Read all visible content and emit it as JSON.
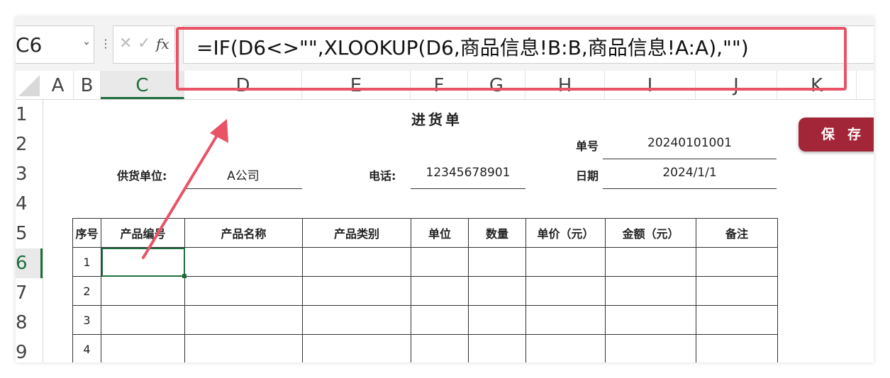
{
  "name_box": {
    "value": "C6",
    "dropdown_icon": "chevron-down-icon"
  },
  "formula_bar": {
    "cancel_icon": "cancel-x-icon",
    "confirm_icon": "checkmark-icon",
    "fx_label": "fx",
    "formula": "=IF(D6<>\"\",XLOOKUP(D6,商品信息!B:B,商品信息!A:A),\"\")"
  },
  "columns": [
    "A",
    "B",
    "C",
    "D",
    "E",
    "F",
    "G",
    "H",
    "I",
    "J",
    "K"
  ],
  "selected_column": "C",
  "rows": [
    "1",
    "2",
    "3",
    "4",
    "5",
    "6",
    "7",
    "8",
    "9"
  ],
  "selected_row": "6",
  "sheet": {
    "title": "进货单",
    "order_no_label": "单号",
    "order_no": "20240101001",
    "supplier_label": "供货单位:",
    "supplier": "A公司",
    "phone_label": "电话:",
    "phone": "12345678901",
    "date_label": "日期",
    "date": "2024/1/1",
    "table": {
      "headers": [
        "序号",
        "产品编号",
        "产品名称",
        "产品类别",
        "单位",
        "数量",
        "单价（元）",
        "金额（元）",
        "备注"
      ],
      "row_numbers": [
        "1",
        "2",
        "3",
        "4"
      ]
    }
  },
  "save_button": {
    "label": "保存"
  },
  "colors": {
    "accent_green": "#1e6e3d",
    "save_red": "#a32638",
    "highlight": "#e85366"
  }
}
